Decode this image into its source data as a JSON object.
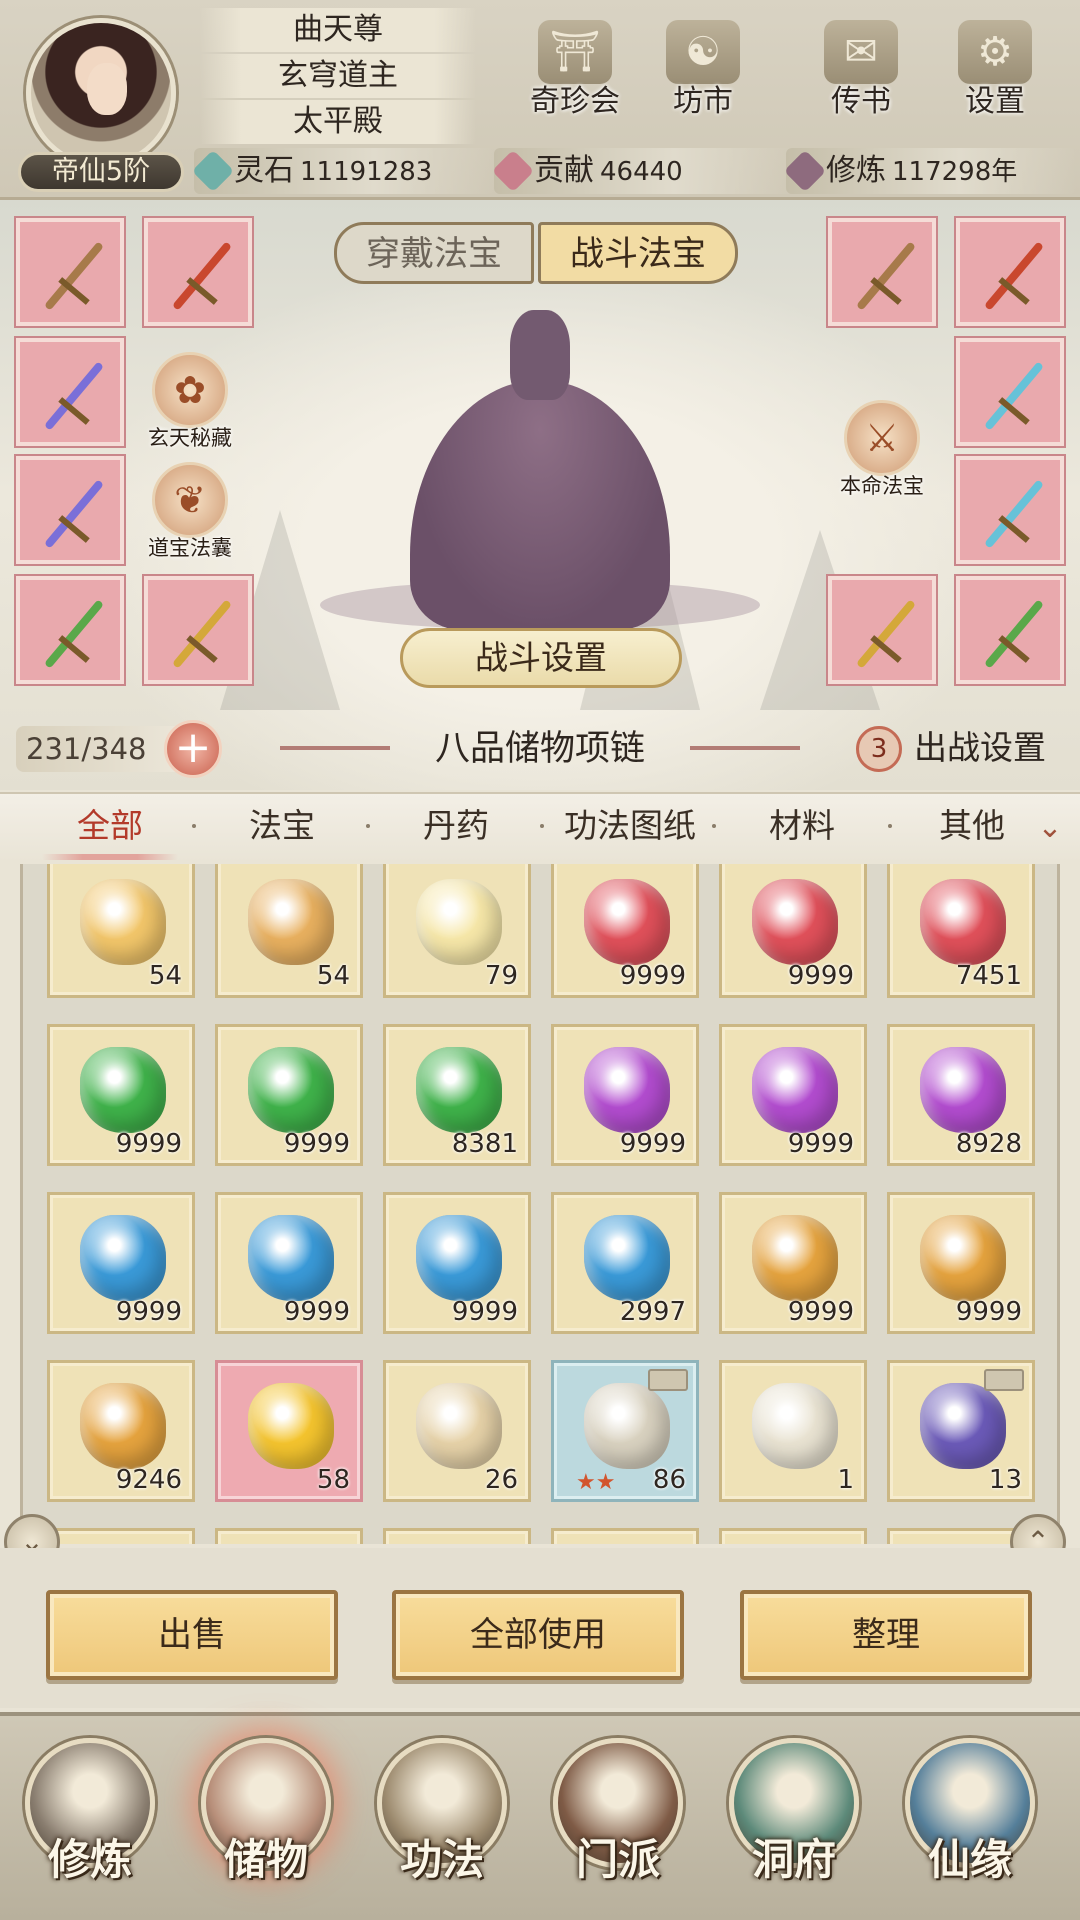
{
  "player": {
    "rank": "帝仙5阶",
    "titles": [
      "曲天尊",
      "玄穹道主",
      "太平殿"
    ]
  },
  "top_menu": [
    {
      "label": "奇珍会",
      "icon": "pavilion-icon"
    },
    {
      "label": "坊市",
      "icon": "market-icon"
    },
    {
      "label": "传书",
      "icon": "scroll-message-icon"
    },
    {
      "label": "设置",
      "icon": "gear-icon"
    }
  ],
  "currencies": [
    {
      "name": "灵石",
      "value": "11191283",
      "icon": "spirit-stone-icon",
      "color": "#6fb0a8"
    },
    {
      "name": "贡献",
      "value": "46440",
      "icon": "contribution-icon",
      "color": "#c97f8c"
    },
    {
      "name": "修炼",
      "value": "117298年",
      "icon": "cultivation-icon",
      "color": "#8e6b7e"
    }
  ],
  "treasure_tabs": {
    "worn": "穿戴法宝",
    "battle": "战斗法宝",
    "active": "battle"
  },
  "side_buttons": {
    "left": [
      {
        "label": "玄天秘藏",
        "icon": "lotus-swirl-icon"
      },
      {
        "label": "道宝法囊",
        "icon": "pouch-icon"
      }
    ],
    "right": [
      {
        "label": "本命法宝",
        "icon": "sword-icon"
      }
    ]
  },
  "battle_setting_label": "战斗设置",
  "equip_slots": {
    "left": [
      {
        "color": "#a77a4a"
      },
      {
        "color": "#c9472e"
      },
      {
        "color": "#7a6fd8"
      },
      {
        "color": "#7a6fd8"
      },
      {
        "color": "#5aa84a"
      },
      {
        "color": "#d4a83a"
      }
    ],
    "right": [
      {
        "color": "#c9472e"
      },
      {
        "color": "#a77a4a"
      },
      {
        "color": "#66c2d8"
      },
      {
        "color": "#66c2d8"
      },
      {
        "color": "#5aa84a"
      },
      {
        "color": "#d4a83a"
      }
    ]
  },
  "bag": {
    "capacity": "231/348",
    "name": "八品储物项链",
    "deploy_count": "3",
    "deploy_label": "出战设置"
  },
  "filters": {
    "tabs": [
      "全部",
      "法宝",
      "丹药",
      "功法图纸",
      "材料",
      "其他"
    ],
    "active": "全部"
  },
  "items": [
    {
      "qty": "54",
      "kind": "feather",
      "color": "#f2c66a",
      "frame": "gold"
    },
    {
      "qty": "54",
      "kind": "horn",
      "color": "#e8b05f",
      "frame": "gold"
    },
    {
      "qty": "79",
      "kind": "crystal",
      "color": "#f6e7a8",
      "frame": "gold"
    },
    {
      "qty": "9999",
      "kind": "red-gem",
      "color": "#e0505a",
      "frame": "gold"
    },
    {
      "qty": "9999",
      "kind": "red-gem",
      "color": "#e0505a",
      "frame": "gold"
    },
    {
      "qty": "7451",
      "kind": "red-gem",
      "color": "#e0505a",
      "frame": "gold"
    },
    {
      "qty": "9999",
      "kind": "green-gem",
      "color": "#3fb24a",
      "frame": "gold"
    },
    {
      "qty": "9999",
      "kind": "green-gem",
      "color": "#3fb24a",
      "frame": "gold"
    },
    {
      "qty": "8381",
      "kind": "green-gem",
      "color": "#3fb24a",
      "frame": "gold"
    },
    {
      "qty": "9999",
      "kind": "purple-gem",
      "color": "#b24ccf",
      "frame": "gold"
    },
    {
      "qty": "9999",
      "kind": "purple-gem",
      "color": "#b24ccf",
      "frame": "gold"
    },
    {
      "qty": "8928",
      "kind": "purple-gem",
      "color": "#b24ccf",
      "frame": "gold"
    },
    {
      "qty": "9999",
      "kind": "blue-gem",
      "color": "#3a9ad8",
      "frame": "gold"
    },
    {
      "qty": "9999",
      "kind": "blue-gem",
      "color": "#3a9ad8",
      "frame": "gold"
    },
    {
      "qty": "9999",
      "kind": "blue-gem",
      "color": "#3a9ad8",
      "frame": "gold"
    },
    {
      "qty": "2997",
      "kind": "blue-gem",
      "color": "#3a9ad8",
      "frame": "gold"
    },
    {
      "qty": "9999",
      "kind": "orange-gem",
      "color": "#e5a33e",
      "frame": "gold"
    },
    {
      "qty": "9999",
      "kind": "orange-gem",
      "color": "#e5a33e",
      "frame": "gold"
    },
    {
      "qty": "9246",
      "kind": "orange-gem",
      "color": "#e5a33e",
      "frame": "gold"
    },
    {
      "qty": "58",
      "kind": "lightning-crystal",
      "color": "#f4c42e",
      "frame": "pink"
    },
    {
      "qty": "26",
      "kind": "scroll",
      "color": "#e6d2a8",
      "frame": "gold"
    },
    {
      "qty": "86",
      "kind": "book",
      "color": "#d9d2c0",
      "frame": "blue",
      "stars": "★★",
      "locked": true
    },
    {
      "qty": "1",
      "kind": "scroll-fan",
      "color": "#e9e3d2",
      "frame": "gold"
    },
    {
      "qty": "13",
      "kind": "spirit-beast",
      "color": "#6b5ab8",
      "frame": "gold",
      "locked": true
    }
  ],
  "actions": {
    "sell": "出售",
    "use_all": "全部使用",
    "organize": "整理"
  },
  "bottom_nav": [
    {
      "label": "修炼",
      "icon": "cultivate-icon",
      "color": "#8a7e70"
    },
    {
      "label": "储物",
      "icon": "storage-bag-icon",
      "color": "#b88f7a",
      "active": true
    },
    {
      "label": "功法",
      "icon": "technique-scroll-icon",
      "color": "#9d8b6f"
    },
    {
      "label": "门派",
      "icon": "sect-gate-icon",
      "color": "#7f5b46"
    },
    {
      "label": "洞府",
      "icon": "cave-mansion-icon",
      "color": "#5d8a7a"
    },
    {
      "label": "仙缘",
      "icon": "immortal-fate-icon",
      "color": "#557f9a"
    }
  ]
}
